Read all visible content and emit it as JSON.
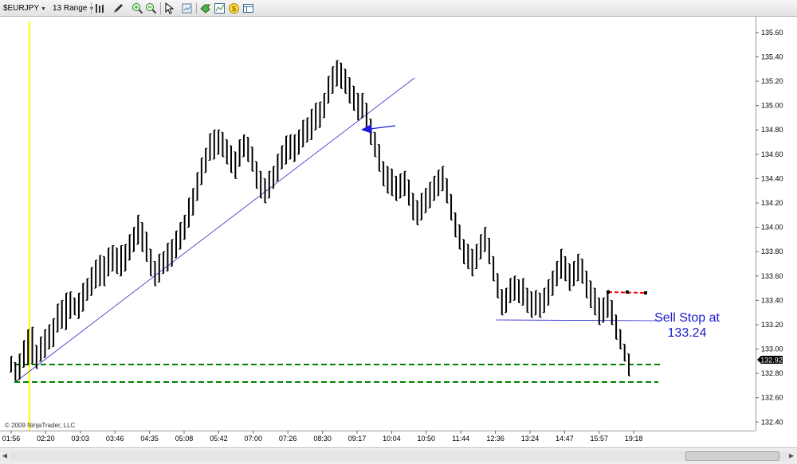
{
  "toolbar": {
    "instrument": "$EURJPY",
    "period": "13 Range"
  },
  "chart_data": {
    "type": "candlestick",
    "instrument": "$EURJPY",
    "bar_type": "13 Range",
    "y_ticks": [
      "135.60",
      "135.40",
      "135.20",
      "135.00",
      "134.80",
      "134.60",
      "134.40",
      "134.20",
      "134.00",
      "133.80",
      "133.60",
      "133.40",
      "133.20",
      "133.00",
      "132.80",
      "132.60",
      "132.40"
    ],
    "ylim": [
      132.33,
      135.73
    ],
    "x_ticks": [
      "01:56",
      "02:20",
      "03:03",
      "03:46",
      "04:35",
      "05:08",
      "05:42",
      "07:00",
      "07:26",
      "08:30",
      "09:17",
      "10:04",
      "10:50",
      "11:44",
      "12:36",
      "13:24",
      "14:47",
      "15:57",
      "19:18"
    ],
    "last_price": "132.92",
    "copyright": "© 2009 NinjaTrader, LLC",
    "annotation_text": [
      "Sell Stop at",
      "133.24"
    ],
    "bars": [
      [
        132.81,
        132.94
      ],
      [
        132.74,
        132.89
      ],
      [
        132.75,
        132.96
      ],
      [
        132.85,
        133.07
      ],
      [
        132.87,
        133.16
      ],
      [
        132.88,
        133.18
      ],
      [
        132.84,
        133.03
      ],
      [
        132.9,
        133.1
      ],
      [
        132.93,
        133.16
      ],
      [
        133.0,
        133.2
      ],
      [
        133.02,
        133.25
      ],
      [
        133.14,
        133.37
      ],
      [
        133.17,
        133.4
      ],
      [
        133.16,
        133.46
      ],
      [
        133.25,
        133.47
      ],
      [
        133.28,
        133.42
      ],
      [
        133.25,
        133.46
      ],
      [
        133.31,
        133.54
      ],
      [
        133.4,
        133.58
      ],
      [
        133.44,
        133.67
      ],
      [
        133.5,
        133.73
      ],
      [
        133.52,
        133.77
      ],
      [
        133.52,
        133.76
      ],
      [
        133.6,
        133.83
      ],
      [
        133.64,
        133.85
      ],
      [
        133.62,
        133.83
      ],
      [
        133.6,
        133.85
      ],
      [
        133.64,
        133.86
      ],
      [
        133.73,
        133.94
      ],
      [
        133.8,
        134.0
      ],
      [
        133.86,
        134.1
      ],
      [
        133.8,
        134.04
      ],
      [
        133.72,
        133.96
      ],
      [
        133.6,
        133.82
      ],
      [
        133.52,
        133.72
      ],
      [
        133.55,
        133.78
      ],
      [
        133.62,
        133.8
      ],
      [
        133.64,
        133.87
      ],
      [
        133.68,
        133.9
      ],
      [
        133.75,
        133.97
      ],
      [
        133.82,
        134.04
      ],
      [
        133.9,
        134.1
      ],
      [
        134.0,
        134.24
      ],
      [
        134.1,
        134.32
      ],
      [
        134.22,
        134.45
      ],
      [
        134.35,
        134.57
      ],
      [
        134.45,
        134.65
      ],
      [
        134.55,
        134.77
      ],
      [
        134.56,
        134.8
      ],
      [
        134.6,
        134.8
      ],
      [
        134.58,
        134.78
      ],
      [
        134.52,
        134.72
      ],
      [
        134.45,
        134.67
      ],
      [
        134.4,
        134.62
      ],
      [
        134.5,
        134.72
      ],
      [
        134.58,
        134.76
      ],
      [
        134.54,
        134.74
      ],
      [
        134.46,
        134.66
      ],
      [
        134.32,
        134.54
      ],
      [
        134.24,
        134.46
      ],
      [
        134.2,
        134.4
      ],
      [
        134.24,
        134.46
      ],
      [
        134.32,
        134.5
      ],
      [
        134.38,
        134.6
      ],
      [
        134.48,
        134.67
      ],
      [
        134.52,
        134.75
      ],
      [
        134.56,
        134.76
      ],
      [
        134.54,
        134.76
      ],
      [
        134.6,
        134.8
      ],
      [
        134.66,
        134.88
      ],
      [
        134.7,
        134.9
      ],
      [
        134.72,
        134.97
      ],
      [
        134.8,
        135.02
      ],
      [
        134.82,
        135.03
      ],
      [
        134.9,
        135.1
      ],
      [
        135.02,
        135.24
      ],
      [
        135.1,
        135.32
      ],
      [
        135.16,
        135.37
      ],
      [
        135.14,
        135.35
      ],
      [
        135.1,
        135.3
      ],
      [
        135.02,
        135.23
      ],
      [
        134.96,
        135.16
      ],
      [
        134.88,
        135.1
      ],
      [
        134.9,
        135.1
      ],
      [
        134.82,
        135.02
      ],
      [
        134.68,
        134.89
      ],
      [
        134.58,
        134.78
      ],
      [
        134.46,
        134.68
      ],
      [
        134.34,
        134.54
      ],
      [
        134.28,
        134.5
      ],
      [
        134.26,
        134.48
      ],
      [
        134.22,
        134.42
      ],
      [
        134.24,
        134.44
      ],
      [
        134.26,
        134.46
      ],
      [
        134.18,
        134.39
      ],
      [
        134.06,
        134.28
      ],
      [
        134.02,
        134.22
      ],
      [
        134.06,
        134.28
      ],
      [
        134.12,
        134.32
      ],
      [
        134.16,
        134.37
      ],
      [
        134.22,
        134.42
      ],
      [
        134.26,
        134.47
      ],
      [
        134.3,
        134.5
      ],
      [
        134.2,
        134.4
      ],
      [
        134.06,
        134.27
      ],
      [
        133.92,
        134.12
      ],
      [
        133.82,
        134.02
      ],
      [
        133.7,
        133.9
      ],
      [
        133.66,
        133.86
      ],
      [
        133.6,
        133.82
      ],
      [
        133.66,
        133.86
      ],
      [
        133.74,
        133.94
      ],
      [
        133.8,
        134.0
      ],
      [
        133.7,
        133.91
      ],
      [
        133.56,
        133.76
      ],
      [
        133.42,
        133.62
      ],
      [
        133.28,
        133.49
      ],
      [
        133.3,
        133.5
      ],
      [
        133.38,
        133.58
      ],
      [
        133.4,
        133.6
      ],
      [
        133.38,
        133.57
      ],
      [
        133.36,
        133.58
      ],
      [
        133.3,
        133.5
      ],
      [
        133.26,
        133.47
      ],
      [
        133.28,
        133.48
      ],
      [
        133.26,
        133.46
      ],
      [
        133.3,
        133.5
      ],
      [
        133.36,
        133.57
      ],
      [
        133.44,
        133.64
      ],
      [
        133.52,
        133.72
      ],
      [
        133.58,
        133.82
      ],
      [
        133.56,
        133.76
      ],
      [
        133.48,
        133.7
      ],
      [
        133.52,
        133.72
      ],
      [
        133.56,
        133.78
      ],
      [
        133.54,
        133.74
      ],
      [
        133.42,
        133.64
      ],
      [
        133.34,
        133.56
      ],
      [
        133.28,
        133.5
      ],
      [
        133.2,
        133.42
      ],
      [
        133.22,
        133.42
      ],
      [
        133.26,
        133.48
      ],
      [
        133.2,
        133.4
      ],
      [
        133.08,
        133.28
      ],
      [
        133.0,
        133.16
      ],
      [
        132.9,
        133.04
      ],
      [
        132.78,
        132.96
      ]
    ]
  },
  "colors": {
    "bars": "#000000",
    "trendline": "#2a2ad0",
    "vertical_marker": "#ffff00",
    "support_lines": "#008000",
    "stop_line": "#2a2ad0",
    "red_dashed": "#ff0000",
    "arrow": "#1a1ad8",
    "annotation_text": "#1a1ad0"
  },
  "icons": [
    "bar-style-icon",
    "draw-pencil-icon",
    "zoom-in-icon",
    "zoom-out-icon",
    "pointer-icon",
    "chart-properties-icon",
    "order-ticket-icon",
    "indicator-icon",
    "strategy-icon",
    "data-box-icon"
  ]
}
